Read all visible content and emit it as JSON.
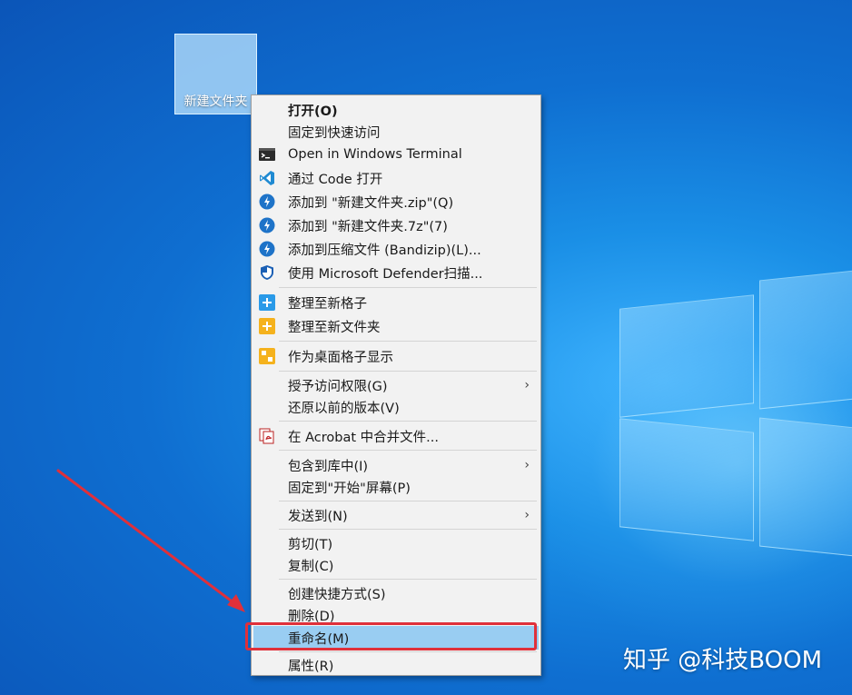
{
  "desktop": {
    "folder_label": "新建文件夹"
  },
  "context_menu": {
    "items": [
      {
        "label": "打开(O)",
        "icon": "none"
      },
      {
        "label": "固定到快速访问",
        "icon": "none"
      },
      {
        "label": "Open in Windows Terminal",
        "icon": "terminal-icon"
      },
      {
        "label": "通过 Code 打开",
        "icon": "vscode-icon"
      },
      {
        "label": "添加到 \"新建文件夹.zip\"(Q)",
        "icon": "bandizip-icon"
      },
      {
        "label": "添加到 \"新建文件夹.7z\"(7)",
        "icon": "bandizip-icon"
      },
      {
        "label": "添加到压缩文件 (Bandizip)(L)...",
        "icon": "bandizip-icon"
      },
      {
        "label": "使用 Microsoft Defender扫描...",
        "icon": "defender-shield-icon"
      },
      {
        "label": "整理至新格子",
        "icon": "fences-plus-icon"
      },
      {
        "label": "整理至新文件夹",
        "icon": "folder-plus-icon"
      },
      {
        "label": "作为桌面格子显示",
        "icon": "fences-icon"
      },
      {
        "label": "授予访问权限(G)",
        "icon": "none",
        "submenu": true
      },
      {
        "label": "还原以前的版本(V)",
        "icon": "none"
      },
      {
        "label": "在 Acrobat 中合并文件...",
        "icon": "acrobat-icon"
      },
      {
        "label": "包含到库中(I)",
        "icon": "none",
        "submenu": true
      },
      {
        "label": "固定到\"开始\"屏幕(P)",
        "icon": "none"
      },
      {
        "label": "发送到(N)",
        "icon": "none",
        "submenu": true
      },
      {
        "label": "剪切(T)",
        "icon": "none"
      },
      {
        "label": "复制(C)",
        "icon": "none"
      },
      {
        "label": "创建快捷方式(S)",
        "icon": "none"
      },
      {
        "label": "删除(D)",
        "icon": "none"
      },
      {
        "label": "重命名(M)",
        "icon": "none",
        "highlighted": true
      },
      {
        "label": "属性(R)",
        "icon": "none"
      }
    ],
    "submenu_glyph": "›"
  },
  "watermark": "知乎 @科技BOOM",
  "colors": {
    "highlight": "#99cdf2",
    "annotation_red": "#e0303a",
    "menu_bg": "#f2f2f2"
  }
}
